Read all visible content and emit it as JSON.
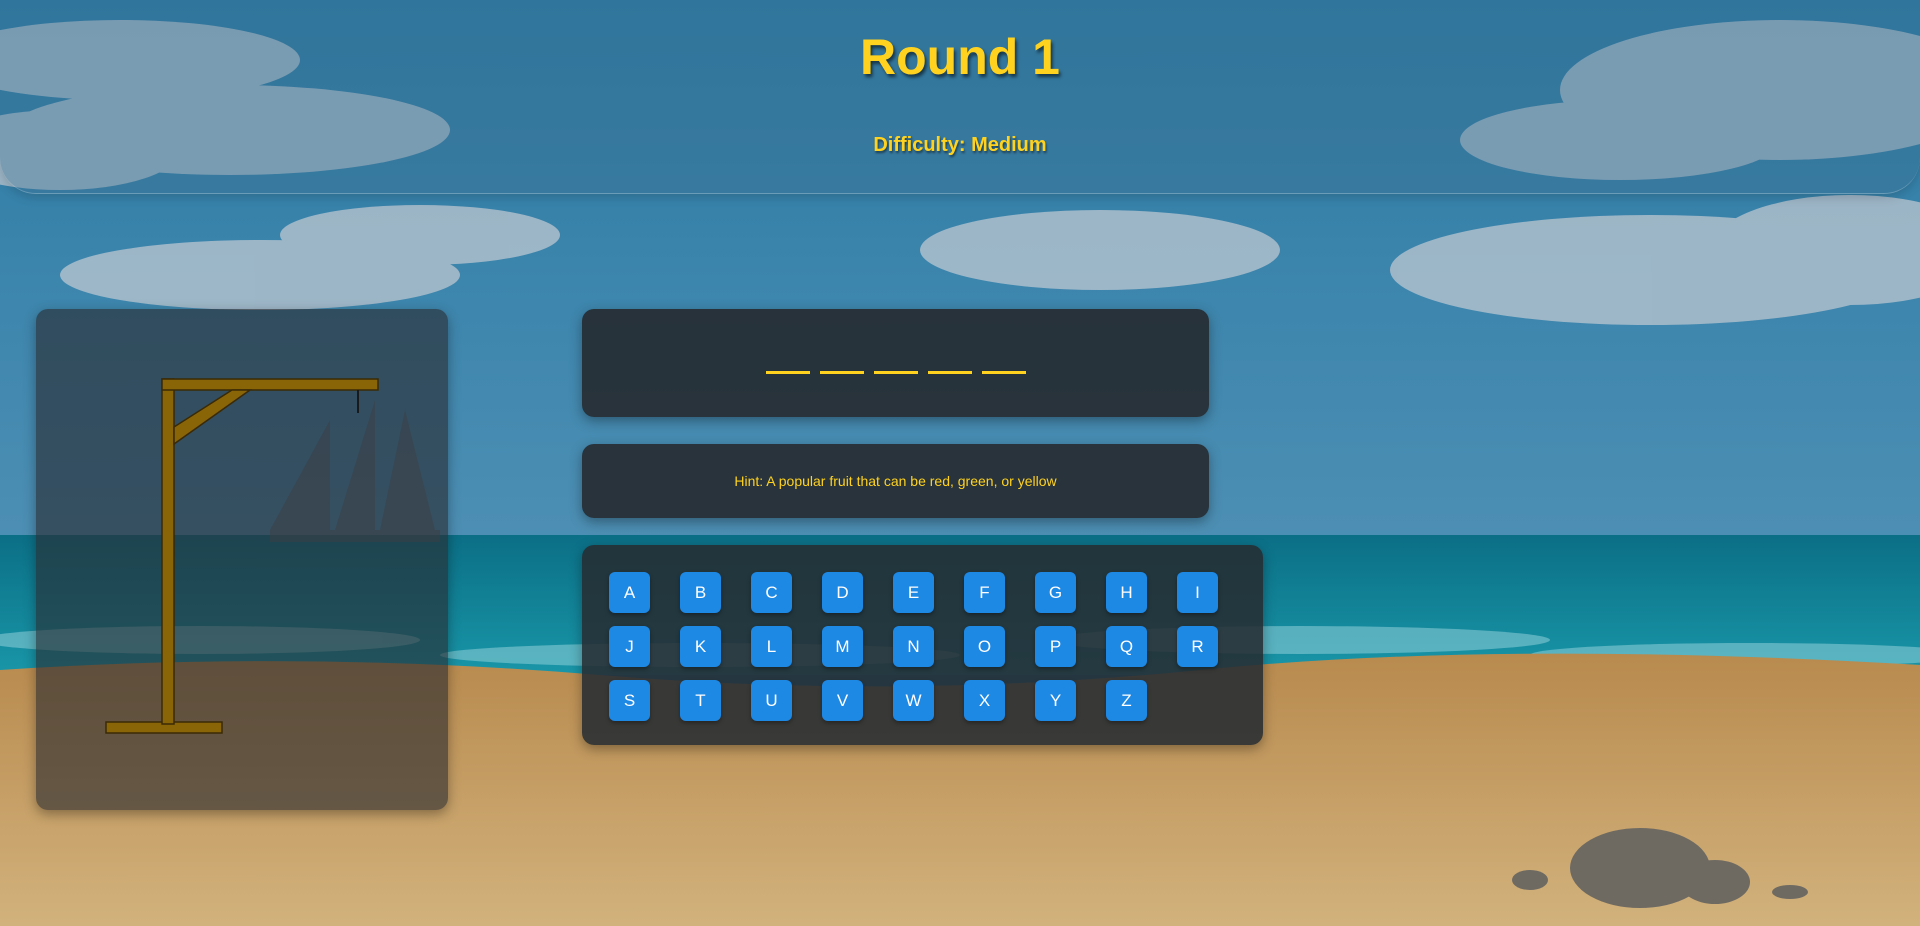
{
  "header": {
    "round_title": "Round 1",
    "difficulty": "Difficulty: Medium"
  },
  "word": {
    "blank_count": 5
  },
  "hint": {
    "text": "Hint: A popular fruit that can be red, green, or yellow"
  },
  "keyboard": {
    "letters": [
      "A",
      "B",
      "C",
      "D",
      "E",
      "F",
      "G",
      "H",
      "I",
      "J",
      "K",
      "L",
      "M",
      "N",
      "O",
      "P",
      "Q",
      "R",
      "S",
      "T",
      "U",
      "V",
      "W",
      "X",
      "Y",
      "Z"
    ]
  },
  "colors": {
    "accent_text": "#ffd21f",
    "letter_button": "#1e88e5",
    "gallows_wood": "#8a6508"
  }
}
